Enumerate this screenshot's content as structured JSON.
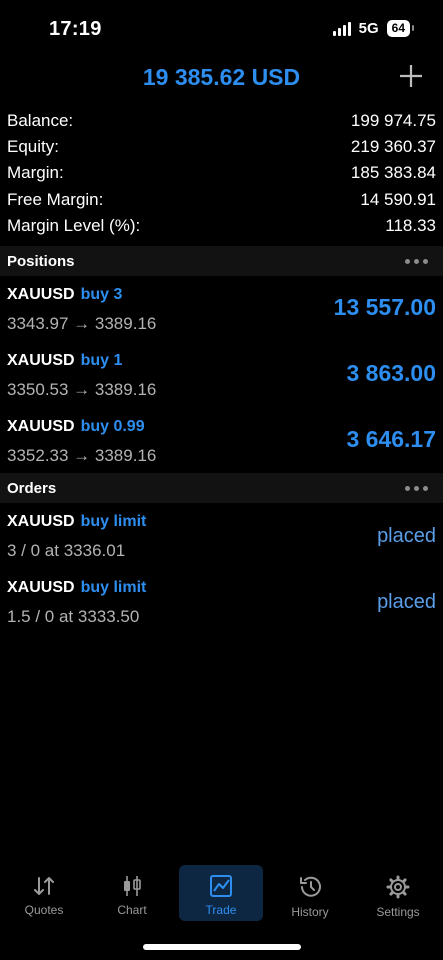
{
  "status": {
    "time": "17:19",
    "network": "5G",
    "battery": "64"
  },
  "header": {
    "title": "19 385.62 USD"
  },
  "account": [
    {
      "label": "Balance:",
      "value": "199 974.75"
    },
    {
      "label": "Equity:",
      "value": "219 360.37"
    },
    {
      "label": "Margin:",
      "value": "185 383.84"
    },
    {
      "label": "Free Margin:",
      "value": "14 590.91"
    },
    {
      "label": "Margin Level (%):",
      "value": "118.33"
    }
  ],
  "positions": {
    "title": "Positions",
    "items": [
      {
        "symbol": "XAUUSD",
        "type": "buy 3",
        "prices": "3343.97 → 3389.16",
        "profit": "13 557.00"
      },
      {
        "symbol": "XAUUSD",
        "type": "buy 1",
        "prices": "3350.53 → 3389.16",
        "profit": "3 863.00"
      },
      {
        "symbol": "XAUUSD",
        "type": "buy 0.99",
        "prices": "3352.33 → 3389.16",
        "profit": "3 646.17"
      }
    ]
  },
  "orders": {
    "title": "Orders",
    "items": [
      {
        "symbol": "XAUUSD",
        "type": "buy limit",
        "details": "3 / 0 at 3336.01",
        "status": "placed"
      },
      {
        "symbol": "XAUUSD",
        "type": "buy limit",
        "details": "1.5 / 0 at 3333.50",
        "status": "placed"
      }
    ]
  },
  "tabs": [
    {
      "label": "Quotes",
      "icon": "quotes-icon"
    },
    {
      "label": "Chart",
      "icon": "candlestick-icon"
    },
    {
      "label": "Trade",
      "icon": "trade-icon",
      "active": true
    },
    {
      "label": "History",
      "icon": "history-icon"
    },
    {
      "label": "Settings",
      "icon": "gear-icon"
    }
  ],
  "colors": {
    "accent": "#2d8ef0",
    "background": "#000000",
    "section": "#121212"
  }
}
